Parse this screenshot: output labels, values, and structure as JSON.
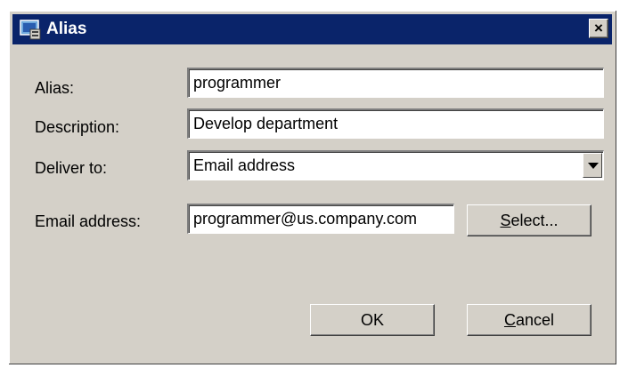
{
  "window": {
    "title": "Alias",
    "close_symbol": "×",
    "icon": "alias-window-icon"
  },
  "form": {
    "alias_label": "Alias:",
    "alias_value": "programmer",
    "description_label": "Description:",
    "description_value": "Develop department",
    "deliver_label": "Deliver to:",
    "deliver_value": "Email address",
    "email_label": "Email address:",
    "email_value": "programmer@us.company.com"
  },
  "buttons": {
    "select_accel": "S",
    "select_rest": "elect...",
    "ok": "OK",
    "cancel_accel": "C",
    "cancel_rest": "ancel"
  },
  "colors": {
    "titlebar": "#0a246a",
    "face": "#d4d0c8"
  }
}
